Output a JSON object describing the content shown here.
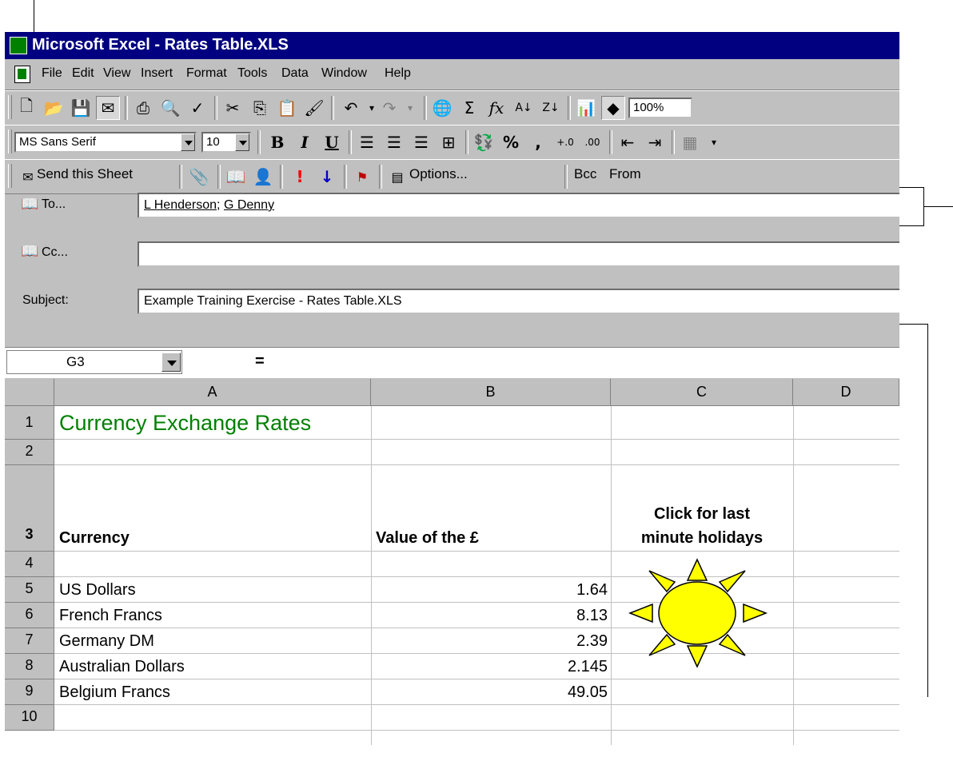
{
  "window": {
    "title": "Microsoft Excel - Rates Table.XLS"
  },
  "menu": [
    "File",
    "Edit",
    "View",
    "Insert",
    "Format",
    "Tools",
    "Data",
    "Window",
    "Help"
  ],
  "standard_toolbar": {
    "zoom": "100%"
  },
  "formatting_toolbar": {
    "font": "MS Sans Serif",
    "size": "10",
    "bold": "B",
    "italic": "I",
    "underline": "U",
    "percent": "%",
    "comma": ","
  },
  "mail_toolbar": {
    "send_label": "Send this Sheet",
    "options_label": "Options...",
    "bcc_label": "Bcc",
    "from_label": "From"
  },
  "mail": {
    "to_label": "To...",
    "to_recipients": [
      "L Henderson",
      "G Denny"
    ],
    "to_separator": ";",
    "cc_label": "Cc...",
    "cc_value": "",
    "subject_label": "Subject:",
    "subject_value": "Example Training Exercise - Rates Table.XLS"
  },
  "formula_bar": {
    "name_box": "G3",
    "equals": "="
  },
  "sheet": {
    "columns": [
      "A",
      "B",
      "C",
      "D"
    ],
    "rows": [
      "1",
      "2",
      "3",
      "4",
      "5",
      "6",
      "7",
      "8",
      "9",
      "10"
    ],
    "title": "Currency Exchange Rates",
    "header_currency": "Currency",
    "header_value": "Value of the £",
    "header_click_line1": "Click for last",
    "header_click_line2": "minute holidays",
    "data": [
      {
        "currency": "US Dollars",
        "value": "1.64"
      },
      {
        "currency": "French Francs",
        "value": "8.13"
      },
      {
        "currency": "Germany DM",
        "value": "2.39"
      },
      {
        "currency": "Australian Dollars",
        "value": "2.145"
      },
      {
        "currency": "Belgium Francs",
        "value": "49.05"
      }
    ]
  },
  "icons": {
    "title_color": "#000080",
    "sheet_title_color": "#008000",
    "sun_color": "#ffff00"
  }
}
